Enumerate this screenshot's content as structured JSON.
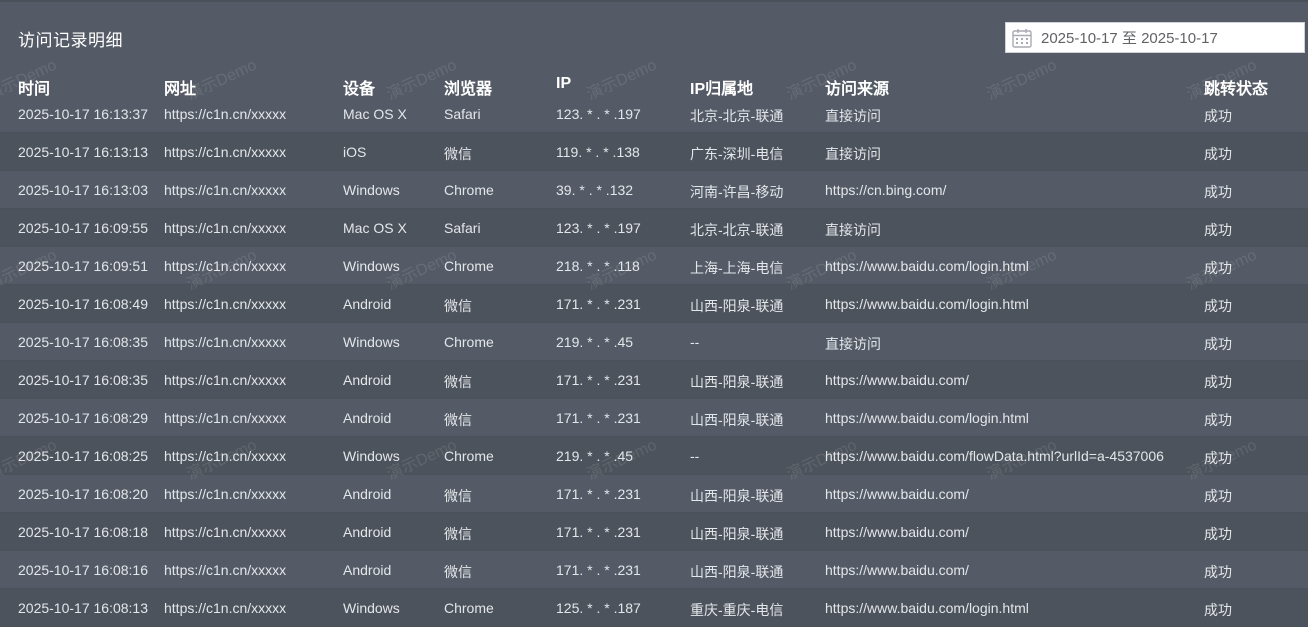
{
  "page": {
    "title": "访问记录明细",
    "date_range": "2025-10-17 至 2025-10-17",
    "watermark_text": "演示Demo"
  },
  "table": {
    "columns": [
      "时间",
      "网址",
      "设备",
      "浏览器",
      "IP",
      "IP归属地",
      "访问来源",
      "跳转状态"
    ],
    "rows": [
      [
        "2025-10-17 16:13:37",
        "https://c1n.cn/xxxxx",
        "Mac OS X",
        "Safari",
        "123. * . * .197",
        "北京-北京-联通",
        "直接访问",
        "成功"
      ],
      [
        "2025-10-17 16:13:13",
        "https://c1n.cn/xxxxx",
        "iOS",
        "微信",
        "119. * . * .138",
        "广东-深圳-电信",
        "直接访问",
        "成功"
      ],
      [
        "2025-10-17 16:13:03",
        "https://c1n.cn/xxxxx",
        "Windows",
        "Chrome",
        "39. * . * .132",
        "河南-许昌-移动",
        "https://cn.bing.com/",
        "成功"
      ],
      [
        "2025-10-17 16:09:55",
        "https://c1n.cn/xxxxx",
        "Mac OS X",
        "Safari",
        "123. * . * .197",
        "北京-北京-联通",
        "直接访问",
        "成功"
      ],
      [
        "2025-10-17 16:09:51",
        "https://c1n.cn/xxxxx",
        "Windows",
        "Chrome",
        "218. * . * .118",
        "上海-上海-电信",
        "https://www.baidu.com/login.html",
        "成功"
      ],
      [
        "2025-10-17 16:08:49",
        "https://c1n.cn/xxxxx",
        "Android",
        "微信",
        "171. * . * .231",
        "山西-阳泉-联通",
        "https://www.baidu.com/login.html",
        "成功"
      ],
      [
        "2025-10-17 16:08:35",
        "https://c1n.cn/xxxxx",
        "Windows",
        "Chrome",
        "219. * . * .45",
        "--",
        "直接访问",
        "成功"
      ],
      [
        "2025-10-17 16:08:35",
        "https://c1n.cn/xxxxx",
        "Android",
        "微信",
        "171. * . * .231",
        "山西-阳泉-联通",
        "https://www.baidu.com/",
        "成功"
      ],
      [
        "2025-10-17 16:08:29",
        "https://c1n.cn/xxxxx",
        "Android",
        "微信",
        "171. * . * .231",
        "山西-阳泉-联通",
        "https://www.baidu.com/login.html",
        "成功"
      ],
      [
        "2025-10-17 16:08:25",
        "https://c1n.cn/xxxxx",
        "Windows",
        "Chrome",
        "219. * . * .45",
        "--",
        "https://www.baidu.com/flowData.html?urlId=a-4537006",
        "成功"
      ],
      [
        "2025-10-17 16:08:20",
        "https://c1n.cn/xxxxx",
        "Android",
        "微信",
        "171. * . * .231",
        "山西-阳泉-联通",
        "https://www.baidu.com/",
        "成功"
      ],
      [
        "2025-10-17 16:08:18",
        "https://c1n.cn/xxxxx",
        "Android",
        "微信",
        "171. * . * .231",
        "山西-阳泉-联通",
        "https://www.baidu.com/",
        "成功"
      ],
      [
        "2025-10-17 16:08:16",
        "https://c1n.cn/xxxxx",
        "Android",
        "微信",
        "171. * . * .231",
        "山西-阳泉-联通",
        "https://www.baidu.com/",
        "成功"
      ],
      [
        "2025-10-17 16:08:13",
        "https://c1n.cn/xxxxx",
        "Windows",
        "Chrome",
        "125. * . * .187",
        "重庆-重庆-电信",
        "https://www.baidu.com/login.html",
        "成功"
      ]
    ]
  }
}
